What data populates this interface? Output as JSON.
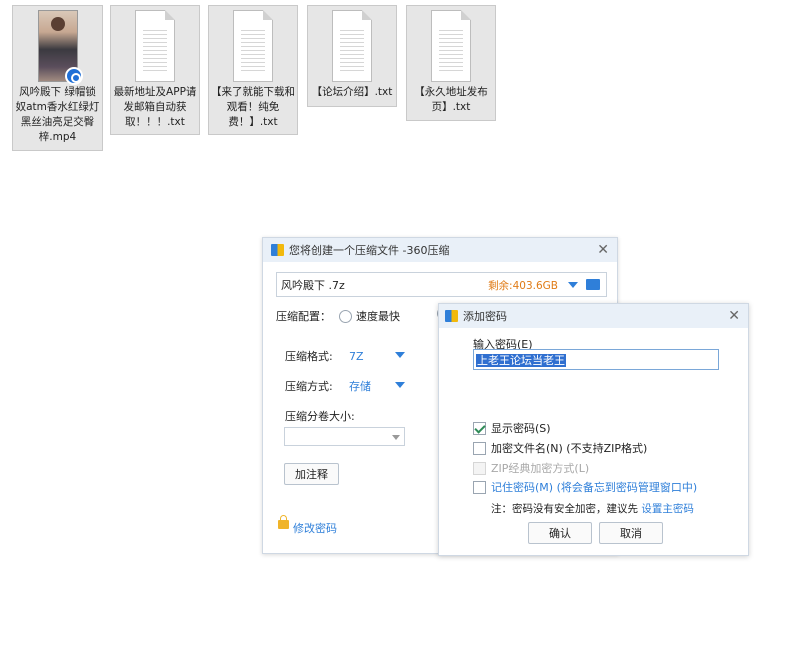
{
  "files": [
    {
      "name": "风吟殿下 绿帽锁奴atm香水红绿灯黑丝油亮足交臀梓.mp4",
      "type": "video"
    },
    {
      "name": "最新地址及APP请发邮箱自动获取！！！.txt",
      "type": "text"
    },
    {
      "name": "【来了就能下载和观看！纯免费！】.txt",
      "type": "text"
    },
    {
      "name": "【论坛介绍】.txt",
      "type": "text"
    },
    {
      "name": "【永久地址发布页】.txt",
      "type": "text"
    }
  ],
  "dialog": {
    "title": "您将创建一个压缩文件 -360压缩",
    "close": "✕",
    "file_name": "风吟殿下 .7z",
    "free_space": "剩余:403.6GB",
    "config_label": "压缩配置：",
    "radio_fastest": "速度最快",
    "format_label": "压缩格式:",
    "format_value": "7Z",
    "method_label": "压缩方式:",
    "method_value": "存储",
    "split_label": "压缩分卷大小:",
    "comment_button": "加注释",
    "change_password": "修改密码"
  },
  "password_dialog": {
    "title": "添加密码",
    "close": "✕",
    "input_label": "输入密码(E)",
    "password_value": "上老王论坛当老王",
    "show_password": "显示密码(S)",
    "encrypt_filename": "加密文件名(N) (不支持ZIP格式)",
    "zip_classic": "ZIP经典加密方式(L)",
    "remember_password": "记住密码(M) (将会备忘到密码管理窗口中)",
    "note_prefix": "注：密码没有安全加密，建议先 ",
    "note_link": "设置主密码",
    "ok": "确认",
    "cancel": "取消"
  }
}
